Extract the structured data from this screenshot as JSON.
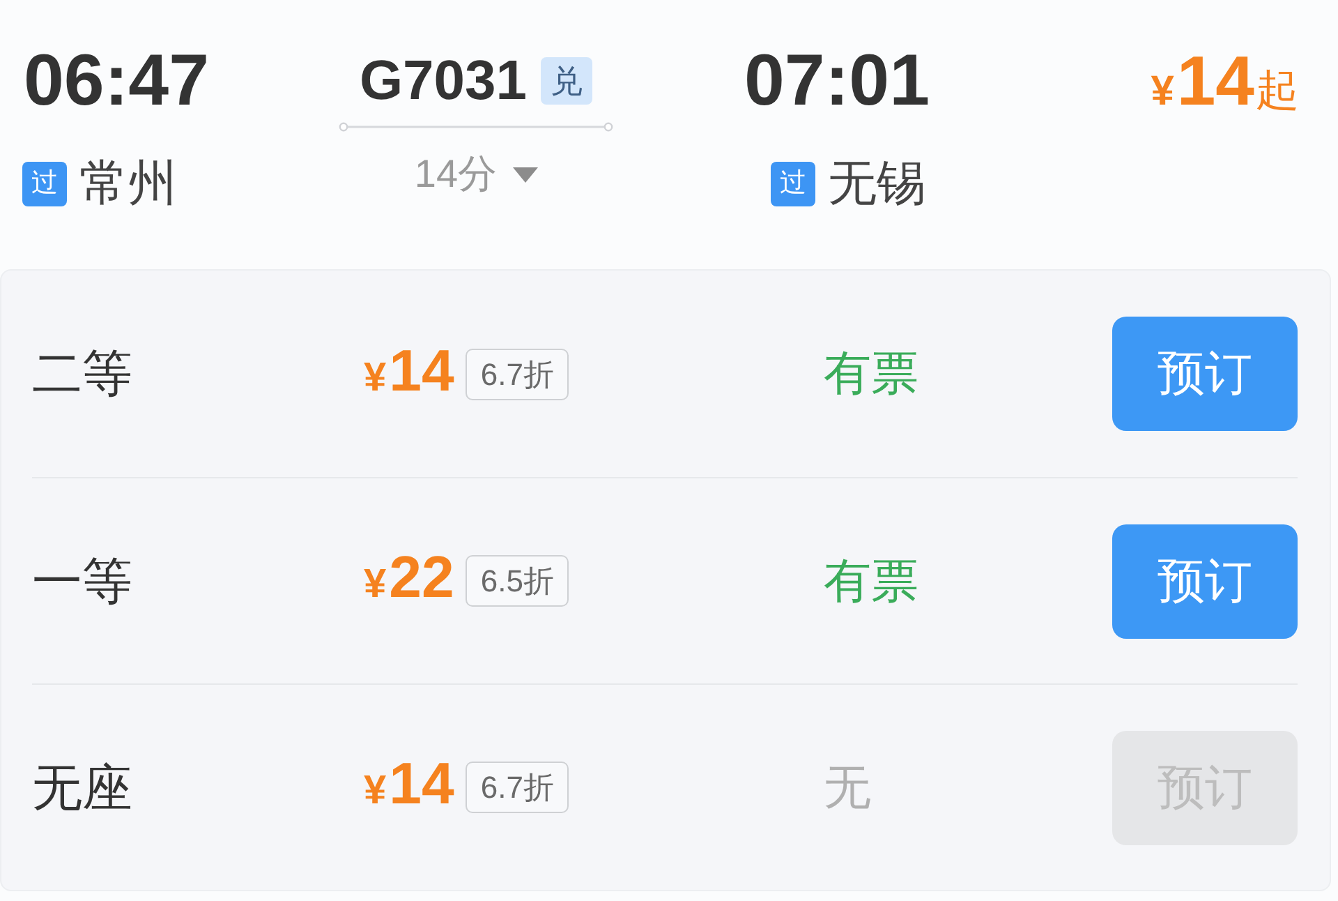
{
  "train": {
    "depart_time": "06:47",
    "depart_station": {
      "badge": "过",
      "name": "常州"
    },
    "number": "G7031",
    "number_badge": "兑",
    "duration": "14分",
    "arrive_time": "07:01",
    "arrive_station": {
      "badge": "过",
      "name": "无锡"
    },
    "min_price": {
      "currency": "¥",
      "amount": "14",
      "suffix": "起"
    }
  },
  "seats": [
    {
      "class": "二等",
      "currency": "¥",
      "price": "14",
      "discount": "6.7折",
      "availability": "有票",
      "available": true,
      "button": "预订",
      "disabled": false
    },
    {
      "class": "一等",
      "currency": "¥",
      "price": "22",
      "discount": "6.5折",
      "availability": "有票",
      "available": true,
      "button": "预订",
      "disabled": false
    },
    {
      "class": "无座",
      "currency": "¥",
      "price": "14",
      "discount": "6.7折",
      "availability": "无",
      "available": false,
      "button": "预订",
      "disabled": true
    }
  ]
}
